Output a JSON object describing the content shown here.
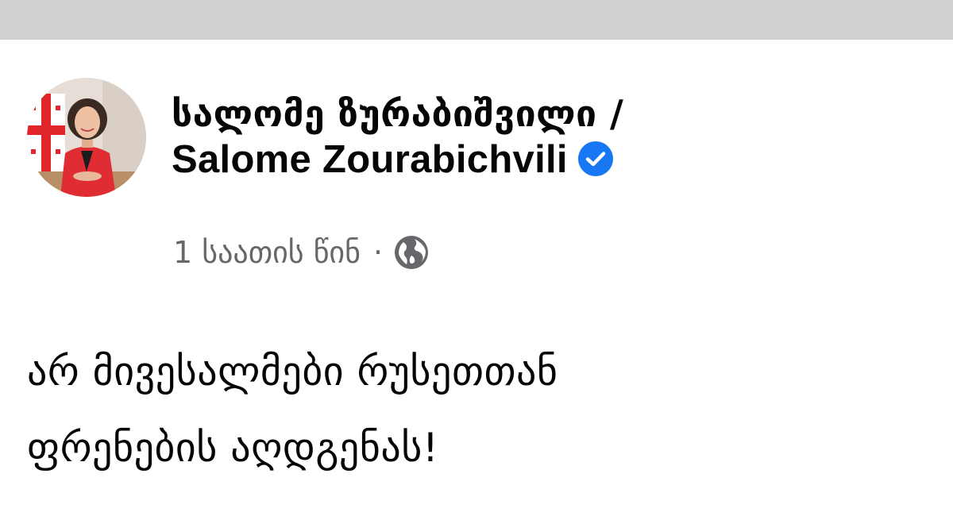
{
  "post": {
    "author_name_ka": "სალომე ზურაბიშვილი /",
    "author_name_en": "Salome Zourabichvili",
    "verified_icon": "verified-badge-icon",
    "timestamp": "1 საათის წინ",
    "separator": "·",
    "audience_icon": "globe-icon",
    "text_line1": "არ მივესალმები რუსეთთან",
    "text_line2": "ფრენების აღდგენას!"
  },
  "colors": {
    "top_bar": "#cfd0d2",
    "verified_blue": "#1877f2",
    "meta_gray": "#65676b",
    "text": "#050505"
  }
}
